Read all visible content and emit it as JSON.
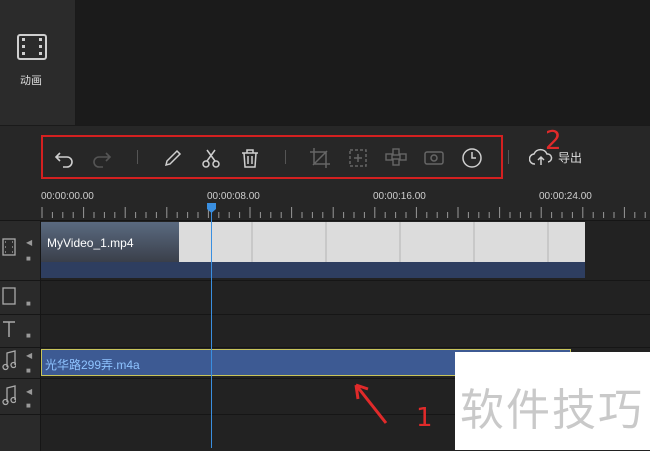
{
  "sidebar": {
    "animation_label": "动画"
  },
  "toolbar": {
    "icons": [
      "undo-icon",
      "redo-icon",
      "edit-icon",
      "scissors-icon",
      "trash-icon",
      "crop-icon",
      "fit-icon",
      "mosaic-icon",
      "freeze-frame-icon",
      "speed-clock-icon"
    ],
    "export_label": "导出"
  },
  "annotations": {
    "label_1": "1",
    "label_2": "2"
  },
  "timeline": {
    "timecodes": [
      "00:00:00.00",
      "00:00:08.00",
      "00:00:16.00",
      "00:00:24.00"
    ],
    "video_clip": "MyVideo_1.mp4",
    "audio_clip": "光华路299弄.m4a"
  },
  "watermark": "软件技巧",
  "colors": {
    "accent": "#3a8fe0",
    "highlight_box": "#d42020",
    "audio_clip": "#3d5a93"
  }
}
